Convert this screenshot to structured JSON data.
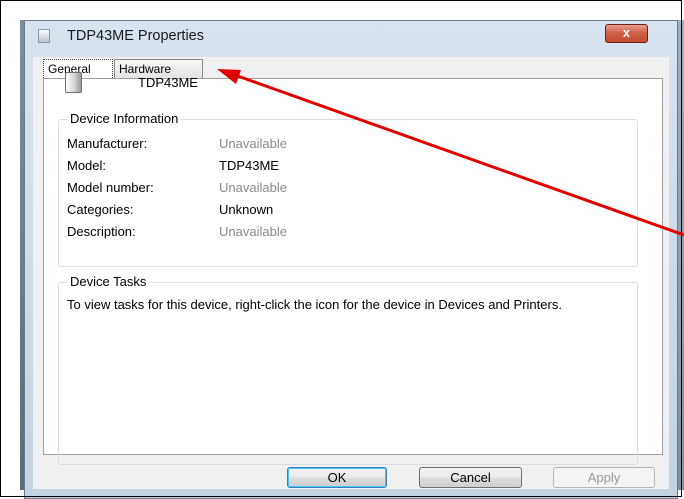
{
  "window": {
    "title": "TDP43ME Properties",
    "close_label": "x"
  },
  "tabs": [
    {
      "label": "General",
      "active": true
    },
    {
      "label": "Hardware",
      "active": false
    }
  ],
  "device": {
    "name": "TDP43ME",
    "icon": "printer-device-icon"
  },
  "device_information": {
    "title": "Device Information",
    "rows": [
      {
        "label": "Manufacturer:",
        "value": "Unavailable",
        "muted": true
      },
      {
        "label": "Model:",
        "value": "TDP43ME",
        "muted": false
      },
      {
        "label": "Model number:",
        "value": "Unavailable",
        "muted": true
      },
      {
        "label": "Categories:",
        "value": "Unknown",
        "muted": false
      },
      {
        "label": "Description:",
        "value": "Unavailable",
        "muted": true
      }
    ]
  },
  "device_tasks": {
    "title": "Device Tasks",
    "text": "To view tasks for this device, right-click the icon for the device in Devices and Printers."
  },
  "buttons": {
    "ok": "OK",
    "cancel": "Cancel",
    "apply": "Apply"
  },
  "colors": {
    "annotation_arrow": "#e00000",
    "close_button": "#c24a32"
  }
}
